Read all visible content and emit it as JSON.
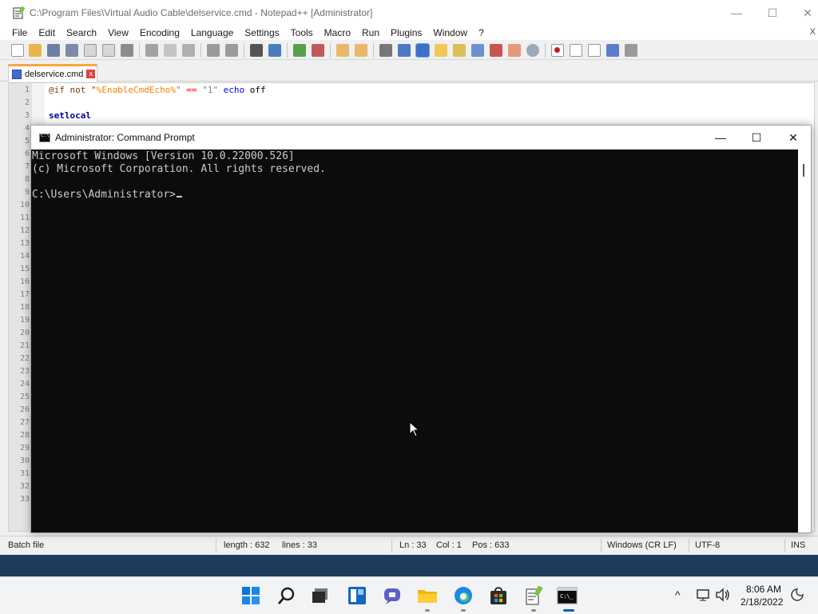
{
  "notepad": {
    "title": "C:\\Program Files\\Virtual Audio Cable\\delservice.cmd - Notepad++ [Administrator]",
    "window_controls": {
      "minimize": "—",
      "maximize": "☐",
      "close": "✕"
    },
    "menu": [
      "File",
      "Edit",
      "Search",
      "View",
      "Encoding",
      "Language",
      "Settings",
      "Tools",
      "Macro",
      "Run",
      "Plugins",
      "Window",
      "?"
    ],
    "menu_close": "X",
    "tab": {
      "label": "delservice.cmd",
      "close": "x"
    },
    "code": {
      "line1": {
        "t1": "@if not \"",
        "t2": "%EnableCmdEcho%",
        "t3": "\" ",
        "t4": "==",
        "t5": " \"1\" ",
        "t6": "echo",
        "t7": " off"
      },
      "line3": "setlocal"
    },
    "line_numbers": [
      "1",
      "2",
      "3",
      "4",
      "5",
      "6",
      "7",
      "8",
      "9",
      "10",
      "11",
      "12",
      "13",
      "14",
      "15",
      "16",
      "17",
      "18",
      "19",
      "20",
      "21",
      "22",
      "23",
      "24",
      "25",
      "26",
      "27",
      "28",
      "29",
      "30",
      "31",
      "32",
      "33"
    ],
    "statusbar": {
      "file_type": "Batch file",
      "length": "length : 632",
      "lines": "lines : 33",
      "ln": "Ln : 33",
      "col": "Col : 1",
      "pos": "Pos : 633",
      "eol": "Windows (CR LF)",
      "encoding": "UTF-8",
      "mode": "INS"
    }
  },
  "cmd": {
    "title": "Administrator: Command Prompt",
    "window_controls": {
      "minimize": "—",
      "maximize": "☐",
      "close": "✕"
    },
    "console_lines": [
      "Microsoft Windows [Version 10.0.22000.526]",
      "(c) Microsoft Corporation. All rights reserved.",
      "",
      "C:\\Users\\Administrator>"
    ]
  },
  "taskbar": {
    "apps": [
      "start-icon",
      "search-icon",
      "task-view-icon",
      "widgets-icon",
      "chat-icon",
      "file-explorer-icon",
      "edge-icon",
      "store-icon",
      "notepad-plus-plus-icon",
      "command-prompt-icon"
    ],
    "tray": {
      "chevron": "^",
      "network": "network-icon",
      "volume": "volume-icon",
      "notifications": "notification-icon"
    },
    "time": "8:06 AM",
    "date": "2/18/2022"
  },
  "colors": {
    "console_bg": "#0c0c0c",
    "console_fg": "#cccccc",
    "tab_accent": "#fba542",
    "editor_gutter": "#e4e4e4"
  }
}
